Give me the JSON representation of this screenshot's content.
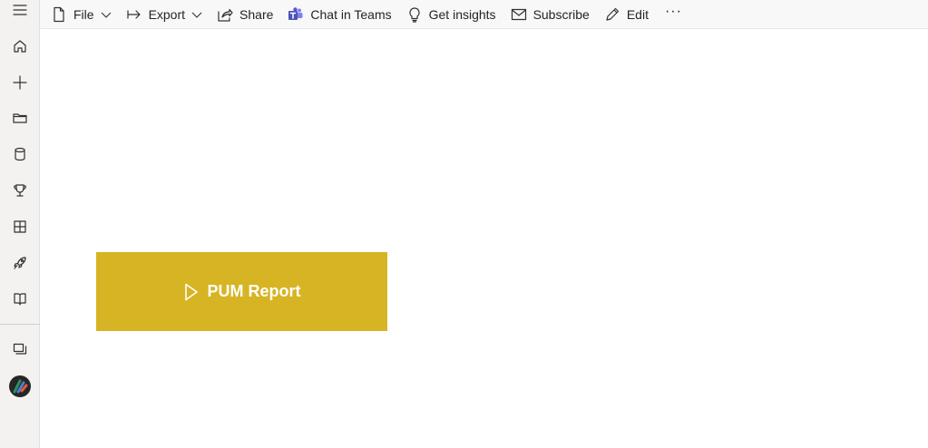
{
  "toolbar": {
    "file_label": "File",
    "export_label": "Export",
    "share_label": "Share",
    "chat_label": "Chat in Teams",
    "insights_label": "Get insights",
    "subscribe_label": "Subscribe",
    "edit_label": "Edit",
    "more_label": "···"
  },
  "sidebar": {
    "items": [
      {
        "icon": "hamburger-menu-icon"
      },
      {
        "icon": "home-icon"
      },
      {
        "icon": "plus-icon"
      },
      {
        "icon": "folder-icon"
      },
      {
        "icon": "database-icon"
      },
      {
        "icon": "trophy-icon"
      },
      {
        "icon": "apps-icon"
      },
      {
        "icon": "rocket-icon"
      },
      {
        "icon": "book-icon"
      },
      {
        "icon": "workspaces-icon"
      },
      {
        "icon": "workspace-logo-icon"
      }
    ]
  },
  "canvas": {
    "report_button_label": "PUM Report"
  },
  "colors": {
    "accent": "#d7b423",
    "rail_bg": "#f3f2f1",
    "toolbar_bg": "#f8f8f8"
  }
}
